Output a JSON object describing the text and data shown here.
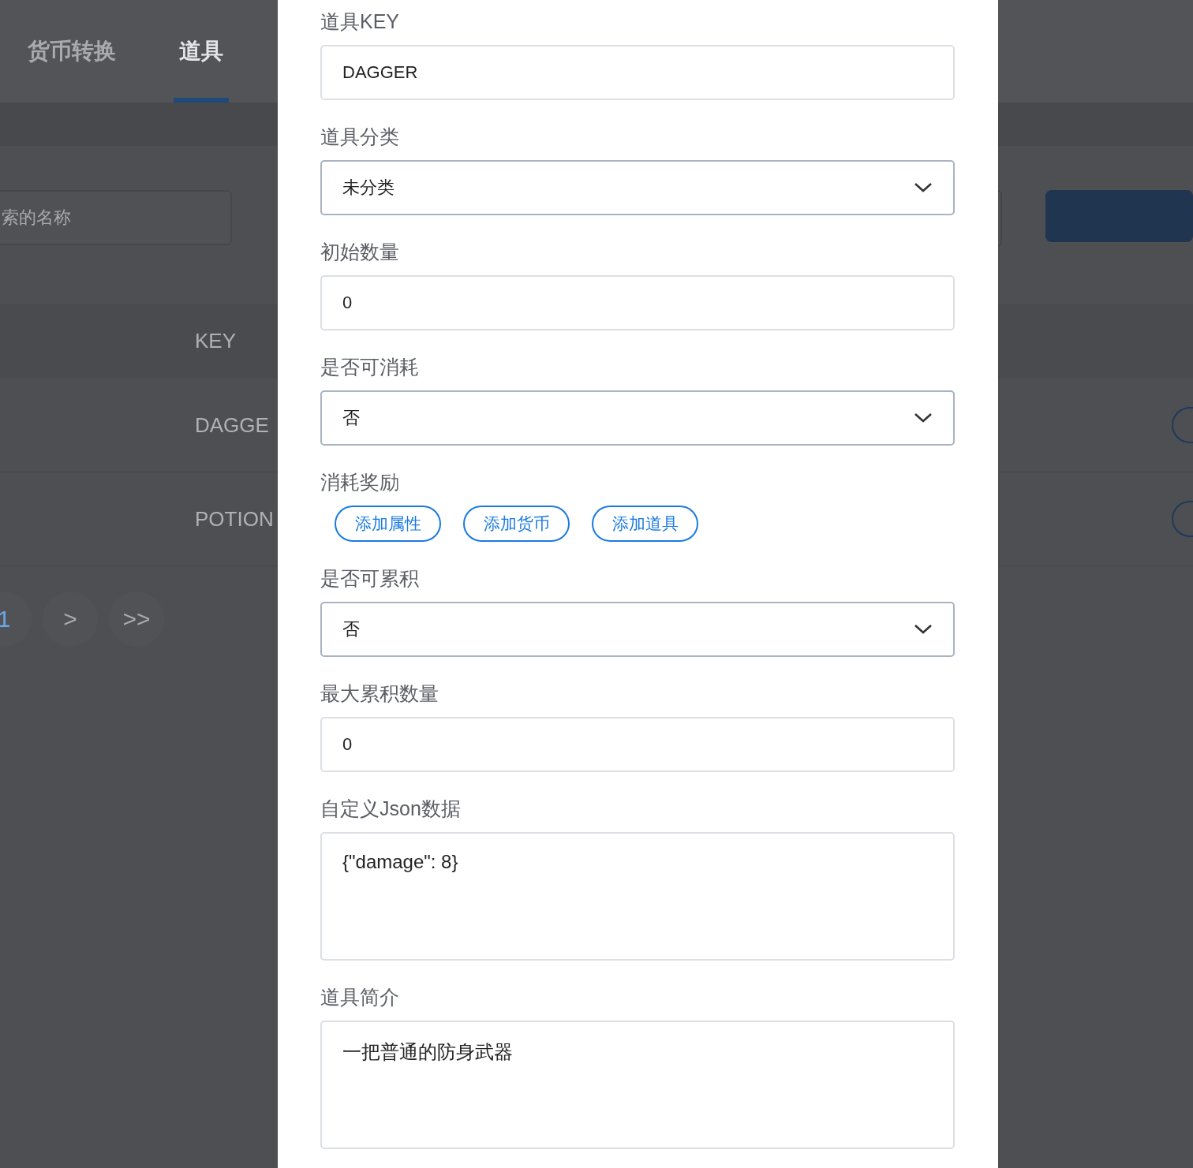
{
  "tabs": [
    {
      "label": "货币转换",
      "selected": false
    },
    {
      "label": "道具",
      "selected": true
    }
  ],
  "search": {
    "placeholder": "索的名称"
  },
  "table": {
    "columns": [
      "KEY"
    ],
    "rows": [
      {
        "key": "DAGGE"
      },
      {
        "key": "POTION"
      }
    ]
  },
  "pagination": {
    "pages": [
      {
        "label": "1",
        "selected": true
      }
    ],
    "next": ">",
    "last": ">>"
  },
  "form": {
    "fields": [
      {
        "kind": "input",
        "label": "道具KEY",
        "value": "DAGGER"
      },
      {
        "kind": "select",
        "label": "道具分类",
        "value": "未分类"
      },
      {
        "kind": "input",
        "label": "初始数量",
        "value": "0"
      },
      {
        "kind": "select",
        "label": "是否可消耗",
        "value": "否"
      },
      {
        "kind": "buttons",
        "label": "消耗奖励",
        "buttons": [
          "添加属性",
          "添加货币",
          "添加道具"
        ]
      },
      {
        "kind": "select",
        "label": "是否可累积",
        "value": "否"
      },
      {
        "kind": "input",
        "label": "最大累积数量",
        "value": "0"
      },
      {
        "kind": "textarea",
        "label": "自定义Json数据",
        "value": "{\"damage\": 8}"
      },
      {
        "kind": "textarea",
        "label": "道具简介",
        "value": "一把普通的防身武器"
      }
    ]
  }
}
